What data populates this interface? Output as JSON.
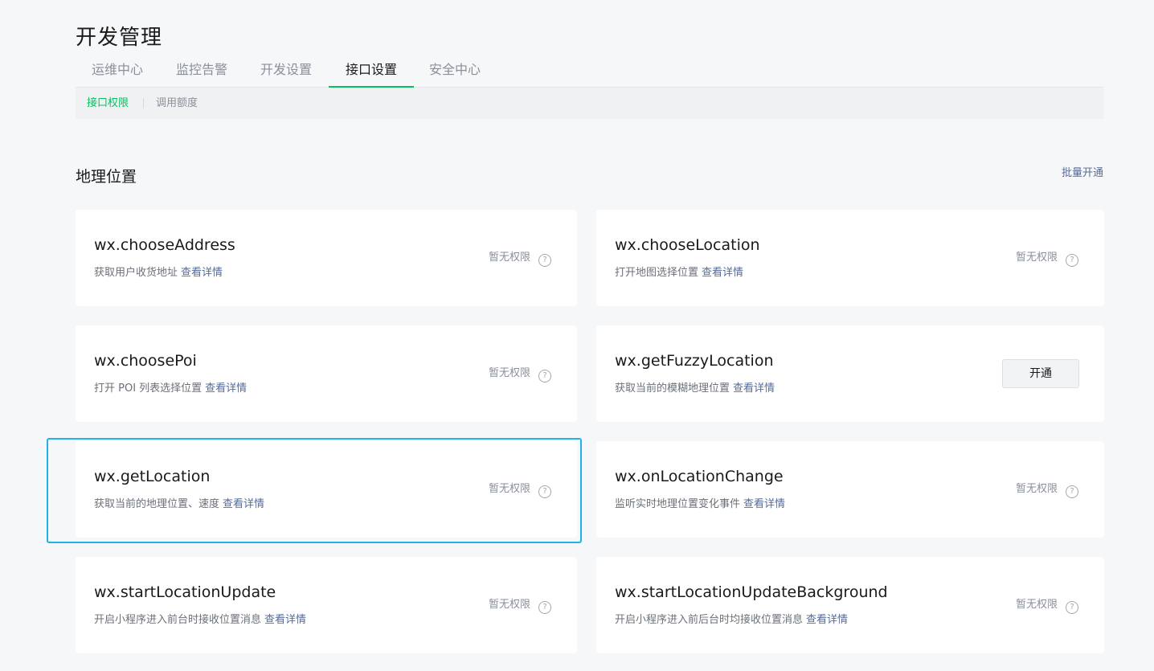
{
  "page": {
    "title": "开发管理"
  },
  "tabs": [
    {
      "label": "运维中心",
      "active": false
    },
    {
      "label": "监控告警",
      "active": false
    },
    {
      "label": "开发设置",
      "active": false
    },
    {
      "label": "接口设置",
      "active": true
    },
    {
      "label": "安全中心",
      "active": false
    }
  ],
  "subnav": [
    {
      "label": "接口权限",
      "active": true
    },
    {
      "label": "调用额度",
      "active": false
    }
  ],
  "section": {
    "title": "地理位置",
    "batch_label": "批量开通"
  },
  "detail_label": "查看详情",
  "no_permission_label": "暂无权限",
  "help_glyph": "?",
  "apis": [
    {
      "name": "wx.chooseAddress",
      "desc": "获取用户收货地址",
      "state": "no-permission"
    },
    {
      "name": "wx.chooseLocation",
      "desc": "打开地图选择位置",
      "state": "no-permission"
    },
    {
      "name": "wx.choosePoi",
      "desc": "打开 POI 列表选择位置",
      "state": "no-permission"
    },
    {
      "name": "wx.getFuzzyLocation",
      "desc": "获取当前的模糊地理位置",
      "state": "openable",
      "action_label": "开通"
    },
    {
      "name": "wx.getLocation",
      "desc": "获取当前的地理位置、速度",
      "state": "no-permission",
      "highlighted": true
    },
    {
      "name": "wx.onLocationChange",
      "desc": "监听实时地理位置变化事件",
      "state": "no-permission"
    },
    {
      "name": "wx.startLocationUpdate",
      "desc": "开启小程序进入前台时接收位置消息",
      "state": "no-permission"
    },
    {
      "name": "wx.startLocationUpdateBackground",
      "desc": "开启小程序进入前后台时均接收位置消息",
      "state": "no-permission"
    }
  ],
  "colors": {
    "accent_green": "#07c160",
    "link_blue": "#576b95",
    "highlight_border": "#1fb3e6",
    "background": "#f6f7f9",
    "card": "#ffffff"
  }
}
